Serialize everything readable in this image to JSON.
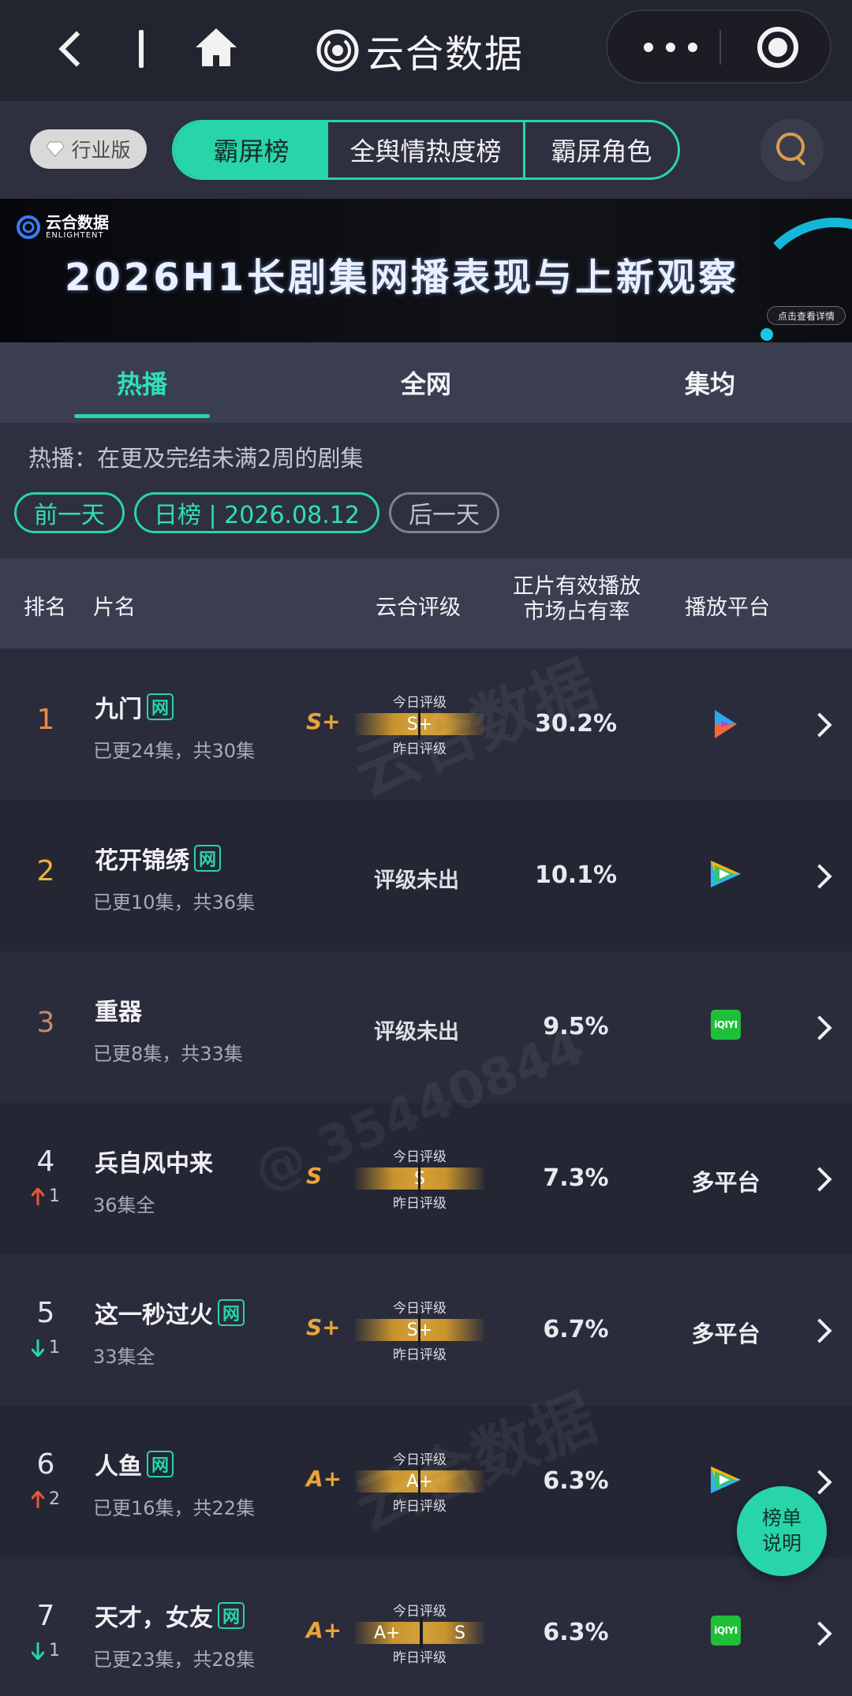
{
  "nav": {
    "title": "云合数据"
  },
  "category_bar": {
    "edition_label": "行业版",
    "segments": [
      "霸屏榜",
      "全舆情热度榜",
      "霸屏角色"
    ],
    "active_segment": 0
  },
  "banner": {
    "logo_cn": "云合数据",
    "logo_en": "ENLIGHTENT",
    "title": "2026H1长剧集网播表现与上新观察",
    "cta": "点击查看详情"
  },
  "tabs": [
    {
      "label": "热播",
      "active": true
    },
    {
      "label": "全网",
      "active": false
    },
    {
      "label": "集均",
      "active": false
    }
  ],
  "info": {
    "description": "热播：在更及完结未满2周的剧集",
    "prev_day": "前一天",
    "date_label": "日榜 | 2026.08.12",
    "next_day": "后一天"
  },
  "table": {
    "headers": {
      "rank": "排名",
      "name": "片名",
      "grade": "云合评级",
      "share_line1": "正片有效播放",
      "share_line2": "市场占有率",
      "platform": "播放平台"
    },
    "grade_today_label": "今日评级",
    "grade_yesterday_label": "昨日评级",
    "net_tag": "网",
    "rows": [
      {
        "rank": "1",
        "title": "九门",
        "net": true,
        "episodes": "已更24集，共30集",
        "grade": "S+",
        "today": "S+",
        "yesterday": "",
        "share": "30.2%",
        "platform": "youku",
        "change": "",
        "change_dir": ""
      },
      {
        "rank": "2",
        "title": "花开锦绣",
        "net": true,
        "episodes": "已更10集，共36集",
        "grade": "",
        "grade_text": "评级未出",
        "share": "10.1%",
        "platform": "tencent",
        "change": "",
        "change_dir": ""
      },
      {
        "rank": "3",
        "title": "重器",
        "net": false,
        "episodes": "已更8集，共33集",
        "grade": "",
        "grade_text": "评级未出",
        "share": "9.5%",
        "platform": "iqiyi",
        "change": "",
        "change_dir": ""
      },
      {
        "rank": "4",
        "title": "兵自风中来",
        "net": false,
        "episodes": "36集全",
        "grade": "S",
        "today": "S",
        "yesterday": "",
        "share": "7.3%",
        "platform_text": "多平台",
        "change": "1",
        "change_dir": "up"
      },
      {
        "rank": "5",
        "title": "这一秒过火",
        "net": true,
        "episodes": "33集全",
        "grade": "S+",
        "today": "S+",
        "yesterday": "",
        "share": "6.7%",
        "platform_text": "多平台",
        "change": "1",
        "change_dir": "down"
      },
      {
        "rank": "6",
        "title": "人鱼",
        "net": true,
        "episodes": "已更16集，共22集",
        "grade": "A+",
        "today": "A+",
        "yesterday": "",
        "share": "6.3%",
        "platform": "tencent",
        "change": "2",
        "change_dir": "up"
      },
      {
        "rank": "7",
        "title": "天才，女友",
        "net": true,
        "episodes": "已更23集，共28集",
        "grade": "A+",
        "today": "A+",
        "yesterday": "S",
        "share": "6.3%",
        "platform": "iqiyi",
        "change": "1",
        "change_dir": "down"
      }
    ]
  },
  "platform_icons": {
    "youku": "youku-icon",
    "tencent": "tencent-video-icon",
    "iqiyi_text": "iQIYI"
  },
  "float_button": {
    "line1": "榜单",
    "line2": "说明"
  },
  "watermarks": {
    "brand": "云合数据",
    "brand_en": "ENLIGHTENT",
    "id": "@ 35440844"
  },
  "colors": {
    "accent": "#27d5a9",
    "gold": "#c9942d",
    "rank1": "#e98a43",
    "rank2": "#f0b33e",
    "rank3": "#c98a6a",
    "up": "#e8573a",
    "down": "#27d5a9"
  }
}
